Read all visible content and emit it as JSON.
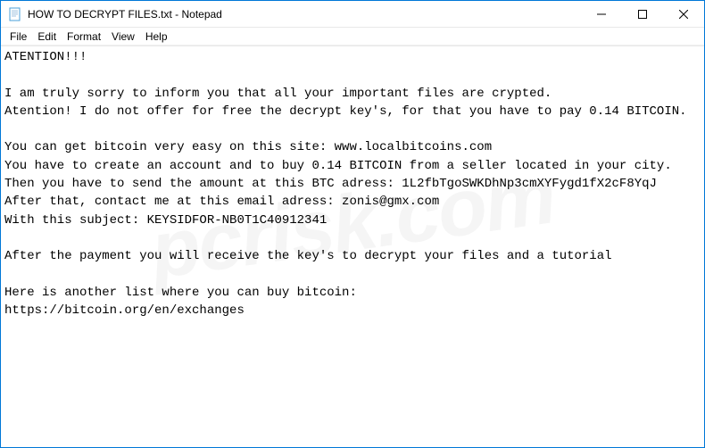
{
  "titlebar": {
    "title": "HOW TO DECRYPT FILES.txt - Notepad"
  },
  "menubar": {
    "file": "File",
    "edit": "Edit",
    "format": "Format",
    "view": "View",
    "help": "Help"
  },
  "content": {
    "text": "ATENTION!!!\n\nI am truly sorry to inform you that all your important files are crypted.\nAtention! I do not offer for free the decrypt key's, for that you have to pay 0.14 BITCOIN.\n\nYou can get bitcoin very easy on this site: www.localbitcoins.com\nYou have to create an account and to buy 0.14 BITCOIN from a seller located in your city.\nThen you have to send the amount at this BTC adress: 1L2fbTgoSWKDhNp3cmXYFygd1fX2cF8YqJ\nAfter that, contact me at this email adress: zonis@gmx.com\nWith this subject: KEYSIDFOR-NB0T1C40912341\n\nAfter the payment you will receive the key's to decrypt your files and a tutorial\n\nHere is another list where you can buy bitcoin:\nhttps://bitcoin.org/en/exchanges"
  },
  "watermark": {
    "text": "pcrisk.com"
  }
}
